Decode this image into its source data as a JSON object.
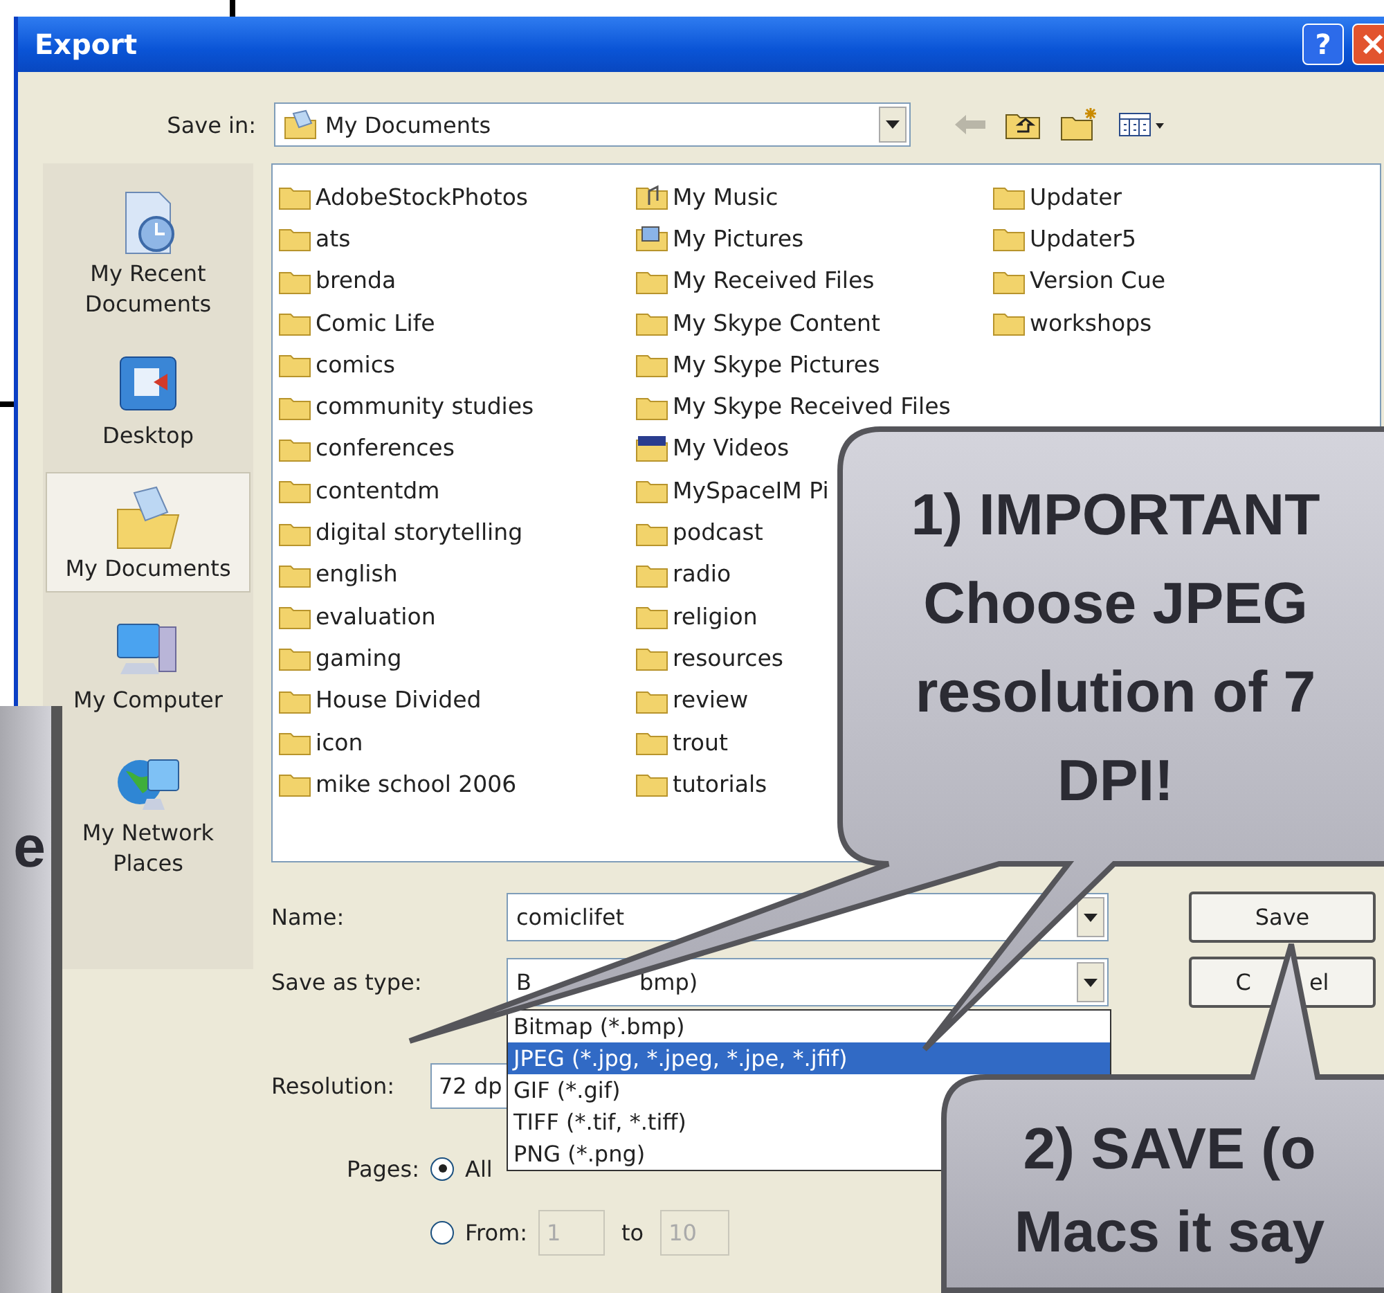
{
  "window": {
    "title": "Export",
    "help": "?"
  },
  "save_in": {
    "label": "Save in:",
    "value": "My Documents"
  },
  "places": [
    {
      "label": "My Recent Documents",
      "kind": "recent",
      "selected": false
    },
    {
      "label": "Desktop",
      "kind": "desktop",
      "selected": false
    },
    {
      "label": "My Documents",
      "kind": "documents",
      "selected": true
    },
    {
      "label": "My Computer",
      "kind": "computer",
      "selected": false
    },
    {
      "label": "My Network Places",
      "kind": "network",
      "selected": false
    }
  ],
  "files": [
    [
      {
        "name": "AdobeStockPhotos",
        "kind": "folder"
      },
      {
        "name": "ats",
        "kind": "folder"
      },
      {
        "name": "brenda",
        "kind": "folder"
      },
      {
        "name": "Comic Life",
        "kind": "folder"
      },
      {
        "name": "comics",
        "kind": "folder"
      },
      {
        "name": "community studies",
        "kind": "folder"
      },
      {
        "name": "conferences",
        "kind": "folder"
      },
      {
        "name": "contentdm",
        "kind": "folder"
      },
      {
        "name": "digital storytelling",
        "kind": "folder"
      },
      {
        "name": "english",
        "kind": "folder"
      },
      {
        "name": "evaluation",
        "kind": "folder"
      },
      {
        "name": "gaming",
        "kind": "folder"
      },
      {
        "name": "House Divided",
        "kind": "folder"
      },
      {
        "name": "icon",
        "kind": "folder"
      },
      {
        "name": "mike school 2006",
        "kind": "folder"
      }
    ],
    [
      {
        "name": "My Music",
        "kind": "music"
      },
      {
        "name": "My Pictures",
        "kind": "pictures"
      },
      {
        "name": "My Received Files",
        "kind": "folder"
      },
      {
        "name": "My Skype Content",
        "kind": "folder"
      },
      {
        "name": "My Skype Pictures",
        "kind": "folder"
      },
      {
        "name": "My Skype Received Files",
        "kind": "folder"
      },
      {
        "name": "My Videos",
        "kind": "videos"
      },
      {
        "name": "MySpaceIM Pi",
        "kind": "folder"
      },
      {
        "name": "podcast",
        "kind": "folder"
      },
      {
        "name": "radio",
        "kind": "folder"
      },
      {
        "name": "religion",
        "kind": "folder"
      },
      {
        "name": "resources",
        "kind": "folder"
      },
      {
        "name": "review",
        "kind": "folder"
      },
      {
        "name": "trout",
        "kind": "folder"
      },
      {
        "name": "tutorials",
        "kind": "folder"
      }
    ],
    [
      {
        "name": "Updater",
        "kind": "folder"
      },
      {
        "name": "Updater5",
        "kind": "folder"
      },
      {
        "name": "Version Cue",
        "kind": "folder"
      },
      {
        "name": "workshops",
        "kind": "folder"
      }
    ]
  ],
  "name_field": {
    "label": "Name:",
    "value": "comiclifet"
  },
  "type_field": {
    "label": "Save as type:",
    "value_parts": [
      "B",
      "bmp)"
    ]
  },
  "type_list": [
    {
      "label": "Bitmap (*.bmp)",
      "selected": false
    },
    {
      "label": "JPEG (*.jpg, *.jpeg, *.jpe, *.jfif)",
      "selected": true
    },
    {
      "label": "GIF (*.gif)",
      "selected": false
    },
    {
      "label": "TIFF (*.tif, *.tiff)",
      "selected": false
    },
    {
      "label": "PNG (*.png)",
      "selected": false
    }
  ],
  "resolution": {
    "label": "Resolution:",
    "value": "72 dp"
  },
  "pages": {
    "label": "Pages:",
    "options": [
      {
        "label": "All",
        "selected": true
      },
      {
        "label": "From:",
        "selected": false
      }
    ],
    "from": "1",
    "to_label": "to",
    "to": "10"
  },
  "buttons": [
    {
      "parts": [
        "Save"
      ]
    },
    {
      "parts": [
        "C",
        "el"
      ]
    }
  ],
  "callouts": [
    {
      "lines": [
        "1) IMPORTANT",
        "Choose JPEG",
        "resolution of 7",
        "DPI!"
      ]
    },
    {
      "lines": [
        "2) SAVE (o",
        "Macs it say"
      ]
    }
  ],
  "side_note": {
    "text": "e"
  }
}
